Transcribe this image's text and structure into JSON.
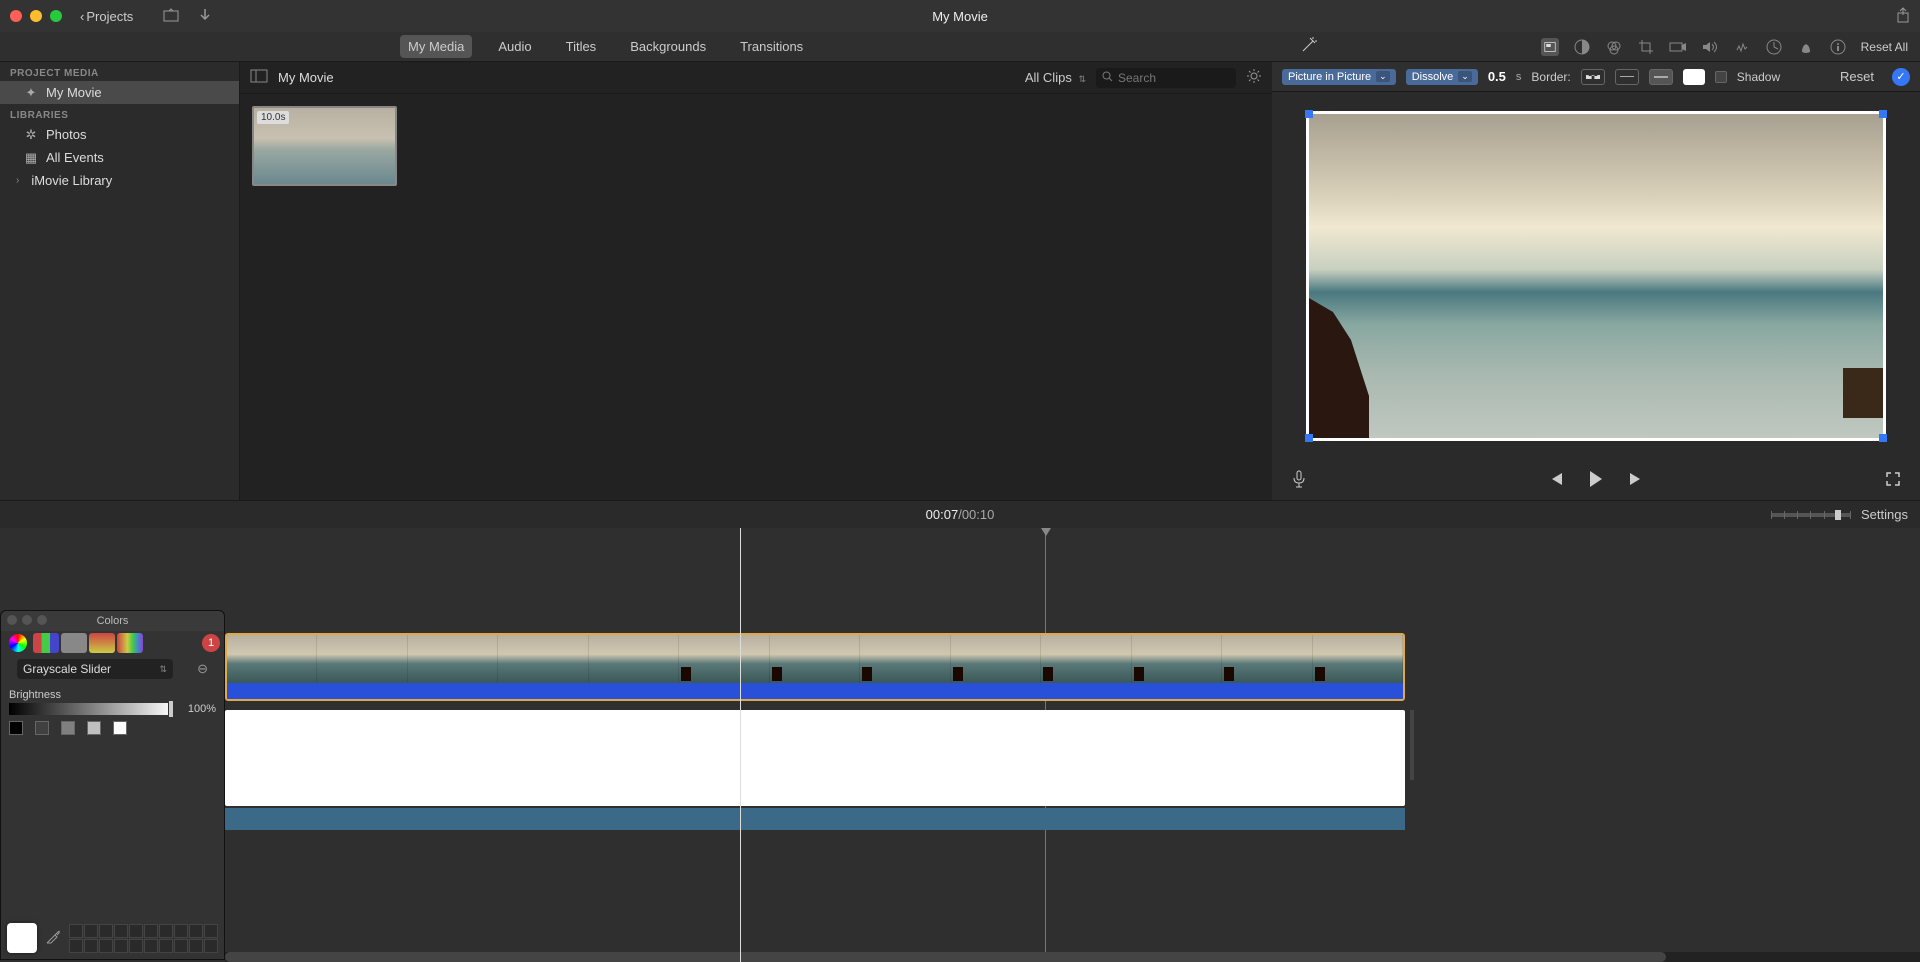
{
  "titlebar": {
    "projects": "Projects",
    "title": "My Movie"
  },
  "toolbar": {
    "tabs": [
      "My Media",
      "Audio",
      "Titles",
      "Backgrounds",
      "Transitions"
    ],
    "active": 0,
    "reset_all": "Reset All"
  },
  "pip": {
    "mode": "Picture in Picture",
    "transition": "Dissolve",
    "duration": "0.5",
    "seconds": "s",
    "border_label": "Border:",
    "shadow_label": "Shadow",
    "reset": "Reset"
  },
  "sidebar": {
    "project_media_h": "PROJECT MEDIA",
    "my_movie": "My Movie",
    "libraries_h": "LIBRARIES",
    "photos": "Photos",
    "all_events": "All Events",
    "imovie_library": "iMovie Library"
  },
  "browser": {
    "title": "My Movie",
    "all_clips": "All Clips",
    "search_ph": "Search",
    "clip_dur": "10.0s"
  },
  "time": {
    "current": "00:07",
    "sep": " / ",
    "total": "00:10",
    "settings": "Settings"
  },
  "colors": {
    "title": "Colors",
    "mode": "Grayscale Slider",
    "brightness_label": "Brightness",
    "brightness_pct": "100%",
    "add_badge": "1",
    "swatches": [
      "#000000",
      "#404040",
      "#808080",
      "#c0c0c0",
      "#ffffff"
    ]
  }
}
